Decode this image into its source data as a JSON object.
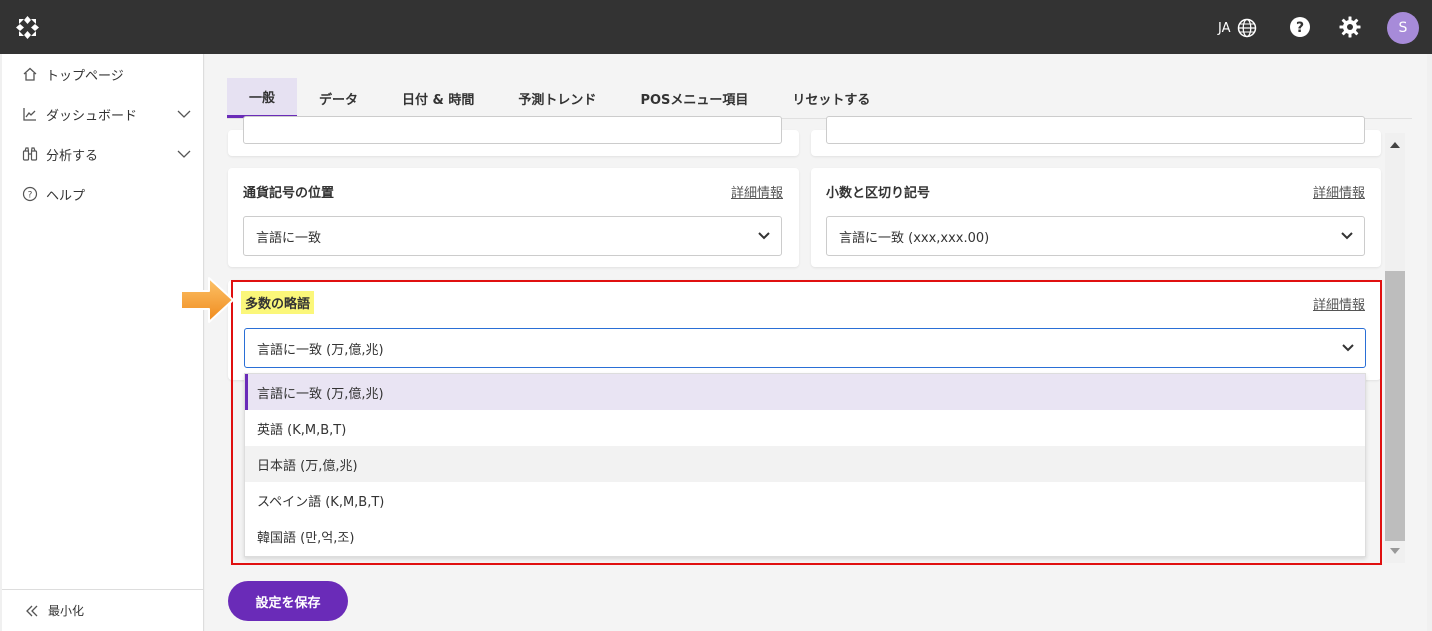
{
  "topbar": {
    "lang_label": "JA",
    "avatar_initial": "S"
  },
  "sidebar": {
    "items": [
      {
        "label": "トップページ",
        "icon": "home-icon"
      },
      {
        "label": "ダッシュボード",
        "icon": "chart-line-icon"
      },
      {
        "label": "分析する",
        "icon": "binoculars-icon"
      },
      {
        "label": "ヘルプ",
        "icon": "help-circle-icon"
      }
    ],
    "minimize_label": "最小化"
  },
  "tabs": [
    {
      "label": "一般",
      "active": true
    },
    {
      "label": "データ"
    },
    {
      "label": "日付 & 時間"
    },
    {
      "label": "予測トレンド"
    },
    {
      "label": "POSメニュー項目"
    },
    {
      "label": "リセットする"
    }
  ],
  "cards": {
    "currency_position": {
      "title": "通貨記号の位置",
      "link": "詳細情報",
      "value": "言語に一致"
    },
    "decimal_separator": {
      "title": "小数と区切り記号",
      "link": "詳細情報",
      "value": "言語に一致 (xxx,xxx.00)"
    },
    "large_number_abbr": {
      "title": "多数の略語",
      "link": "詳細情報",
      "value": "言語に一致 (万,億,兆)"
    }
  },
  "dropdown_options": [
    "言語に一致 (万,億,兆)",
    "英語 (K,M,B,T)",
    "日本語 (万,億,兆)",
    "スペイン語 (K,M,B,T)",
    "韓国語 (만,억,조)"
  ],
  "save_button": "設定を保存",
  "colors": {
    "accent": "#6a2bb8",
    "highlight": "#fbf77a",
    "annotation_red": "#e01010",
    "annotation_arrow": "#f7a13a"
  }
}
